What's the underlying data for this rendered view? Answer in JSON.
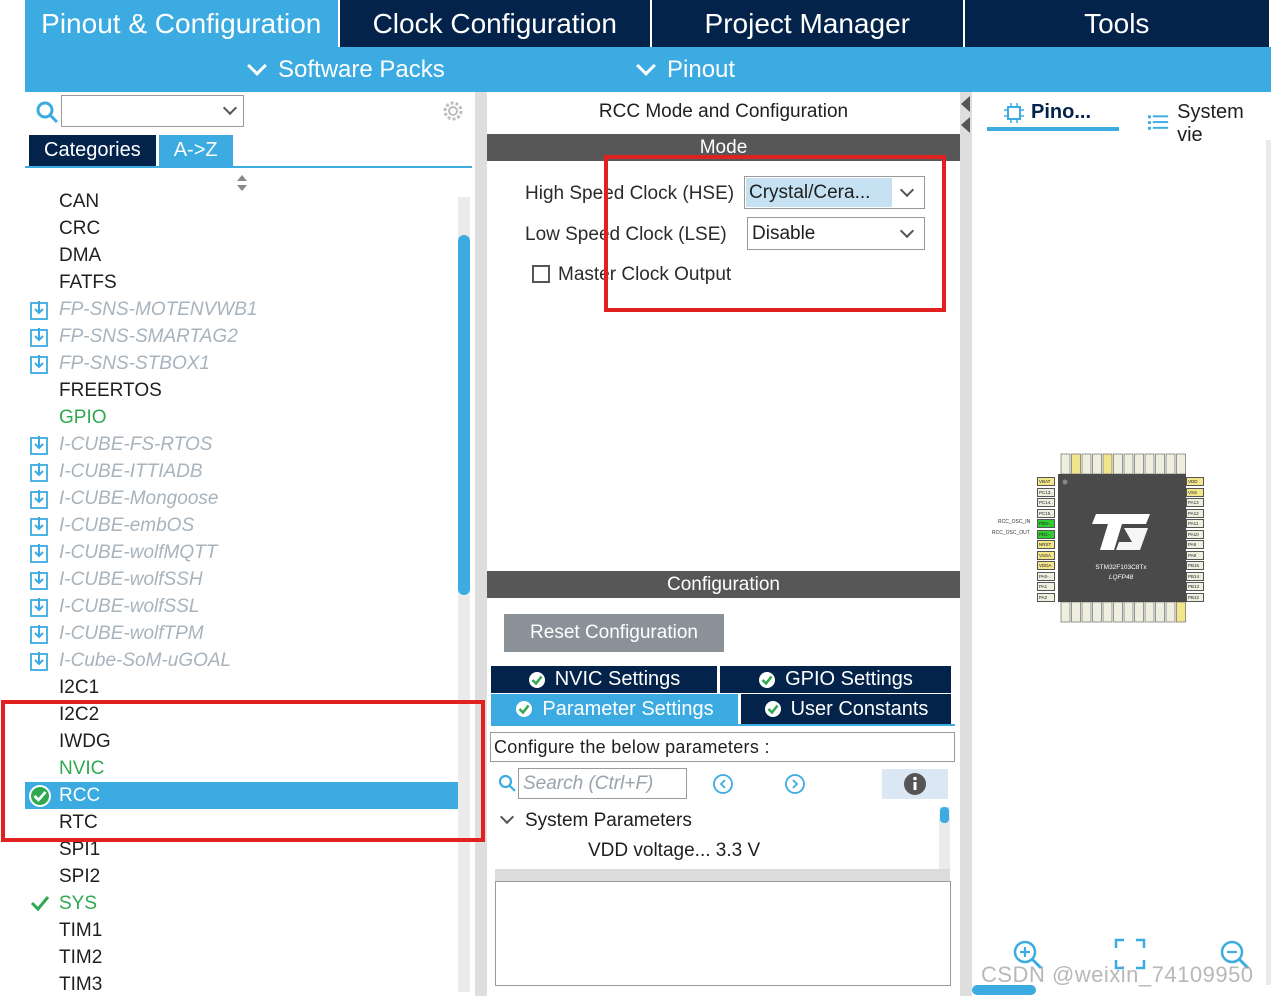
{
  "top_tabs": [
    {
      "label": "Pinout & Configuration",
      "active": true
    },
    {
      "label": "Clock Configuration",
      "active": false
    },
    {
      "label": "Project Manager",
      "active": false
    },
    {
      "label": "Tools",
      "active": false
    }
  ],
  "sub_menu": {
    "software_packs": "Software Packs",
    "pinout": "Pinout"
  },
  "left": {
    "search_value": "",
    "tabs": {
      "categories": "Categories",
      "az": "A->Z"
    },
    "items": [
      {
        "label": "CAN",
        "style": "normal"
      },
      {
        "label": "CRC",
        "style": "normal"
      },
      {
        "label": "DMA",
        "style": "normal"
      },
      {
        "label": "FATFS",
        "style": "normal"
      },
      {
        "label": "FP-SNS-MOTENVWB1",
        "style": "pack"
      },
      {
        "label": "FP-SNS-SMARTAG2",
        "style": "pack"
      },
      {
        "label": "FP-SNS-STBOX1",
        "style": "pack"
      },
      {
        "label": "FREERTOS",
        "style": "normal"
      },
      {
        "label": "GPIO",
        "style": "green"
      },
      {
        "label": "I-CUBE-FS-RTOS",
        "style": "pack"
      },
      {
        "label": "I-CUBE-ITTIADB",
        "style": "pack"
      },
      {
        "label": "I-CUBE-Mongoose",
        "style": "pack"
      },
      {
        "label": "I-CUBE-embOS",
        "style": "pack"
      },
      {
        "label": "I-CUBE-wolfMQTT",
        "style": "pack"
      },
      {
        "label": "I-CUBE-wolfSSH",
        "style": "pack"
      },
      {
        "label": "I-CUBE-wolfSSL",
        "style": "pack"
      },
      {
        "label": "I-CUBE-wolfTPM",
        "style": "pack"
      },
      {
        "label": "I-Cube-SoM-uGOAL",
        "style": "pack"
      },
      {
        "label": "I2C1",
        "style": "normal"
      },
      {
        "label": "I2C2",
        "style": "normal"
      },
      {
        "label": "IWDG",
        "style": "normal"
      },
      {
        "label": "NVIC",
        "style": "green"
      },
      {
        "label": "RCC",
        "style": "selected"
      },
      {
        "label": "RTC",
        "style": "normal"
      },
      {
        "label": "SPI1",
        "style": "normal"
      },
      {
        "label": "SPI2",
        "style": "normal"
      },
      {
        "label": "SYS",
        "style": "green-check"
      },
      {
        "label": "TIM1",
        "style": "normal"
      },
      {
        "label": "TIM2",
        "style": "normal"
      },
      {
        "label": "TIM3",
        "style": "normal"
      }
    ]
  },
  "middle": {
    "title": "RCC Mode and Configuration",
    "mode_header": "Mode",
    "hse_label": "High Speed Clock (HSE)",
    "hse_value": "Crystal/Cera...",
    "lse_label": "Low Speed Clock (LSE)",
    "lse_value": "Disable",
    "mco_label": "Master Clock Output",
    "mco_checked": false,
    "config_header": "Configuration",
    "reset_label": "Reset Configuration",
    "tabs": {
      "nvic": "NVIC Settings",
      "gpio": "GPIO Settings",
      "parameter": "Parameter Settings",
      "user_constants": "User Constants"
    },
    "param_hint": "Configure the below parameters :",
    "search_placeholder": "Search (Ctrl+F)",
    "tree": {
      "group": "System Parameters",
      "vdd_label": "VDD voltage...",
      "vdd_value": "3.3 V"
    }
  },
  "right": {
    "tab_pinout": "Pino...",
    "tab_system": "System vie",
    "chip_name": "STM32F103C8Tx",
    "chip_package": "LQFP48",
    "osc_in_label": "RCC_OSC_IN",
    "osc_out_label": "RCC_OSC_OUT",
    "left_pins": [
      "VBAT",
      "PC13..",
      "PC14..",
      "PC15..",
      "PD0-..",
      "PD1-..",
      "NRST",
      "VSSA",
      "VDDA",
      "PA0-..",
      "PA1",
      "PA2"
    ],
    "right_pins": [
      "VDD",
      "VSS",
      "PA13",
      "PA12",
      "PA11",
      "PA10",
      "PA9",
      "PA8",
      "PB15",
      "PB14",
      "PB13",
      "PB12"
    ],
    "watermark": "CSDN @weixin_74109950"
  },
  "colors": {
    "accent": "#3babe2",
    "dark_navy": "#03234b",
    "section_gray": "#575757",
    "green": "#2fa84f",
    "highlight_red": "#e12020"
  }
}
